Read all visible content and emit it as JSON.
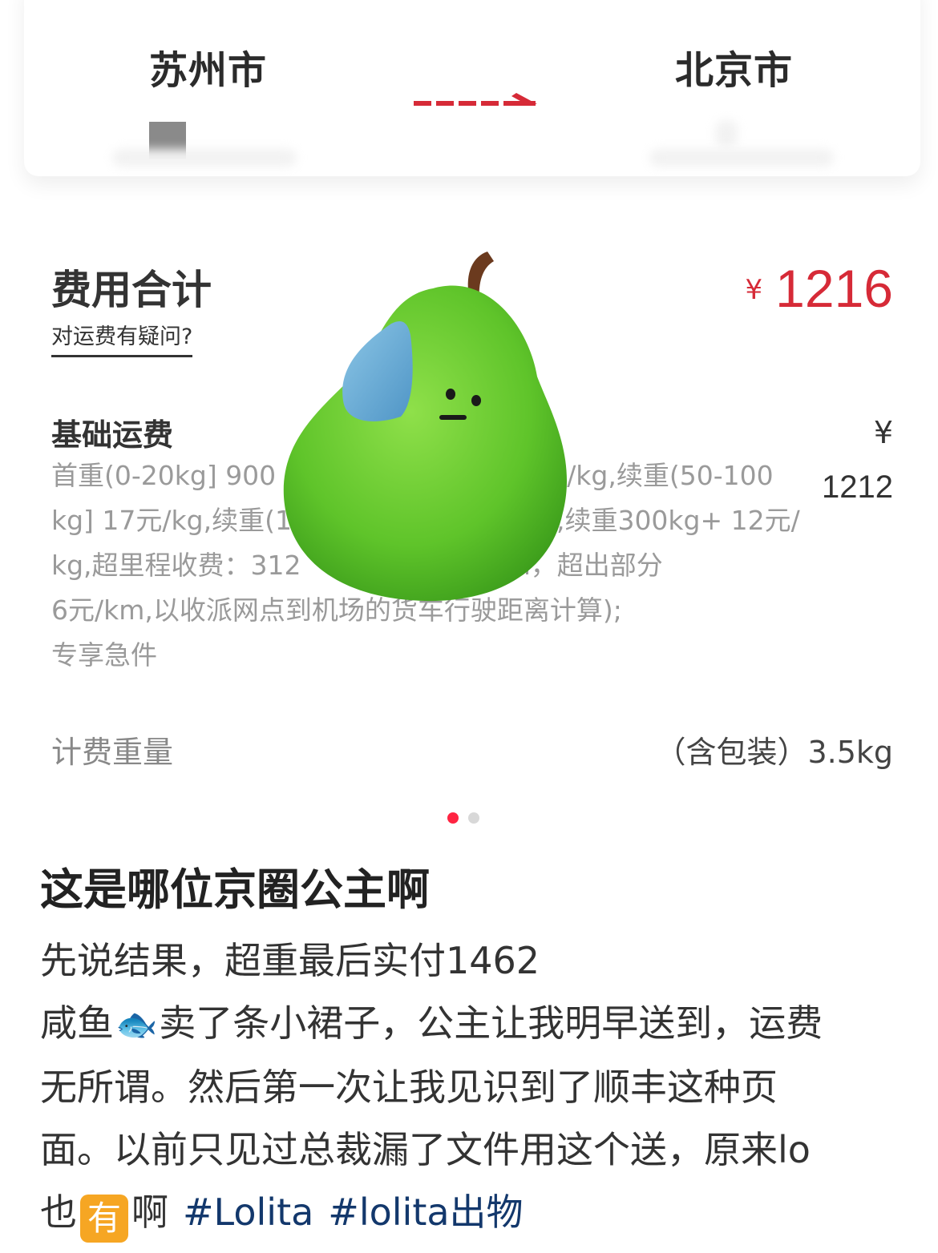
{
  "route": {
    "origin": "苏州市",
    "destination": "北京市"
  },
  "fee": {
    "title": "费用合计",
    "question_link": "对运费有疑问?",
    "currency": "¥",
    "total": "1216"
  },
  "base_fee": {
    "title": "基础运费",
    "currency": "¥",
    "amount": "1212",
    "description_lines": [
      "首重(0-20kg] 900",
      "元/kg,续重(50-100",
      "kg] 17元/kg,续重(1",
      ",续重300kg+ 12元/",
      "kg,超里程收费：312",
      "含30km，超出部分",
      "6元/km,以收派网点到机场的货车行驶距离计算);",
      "专享急件"
    ]
  },
  "weight": {
    "label": "计费重量",
    "value": "（含包装）3.5kg"
  },
  "pagination": {
    "active_color": "#ff2442",
    "inactive_color": "#d8d8d8"
  },
  "post": {
    "title": "这是哪位京圈公主啊",
    "line1": "先说结果，超重最后实付1462",
    "line2_a": "咸鱼",
    "fish_emoji": "🐟",
    "line2_b": "卖了条小裙子，公主让我明早送到，运费",
    "line3": "无所谓。然后第一次让我见识到了顺丰这种页",
    "line4": "面。以前只见过总裁漏了文件用这个送，原来lo",
    "line5_a": "也",
    "badge": "有",
    "line5_b": "啊",
    "tags": [
      "#Lolita",
      "#lolita出物"
    ]
  },
  "colors": {
    "price_red": "#d62a37",
    "tag_blue": "#13386c",
    "badge_orange": "#f6a623"
  }
}
